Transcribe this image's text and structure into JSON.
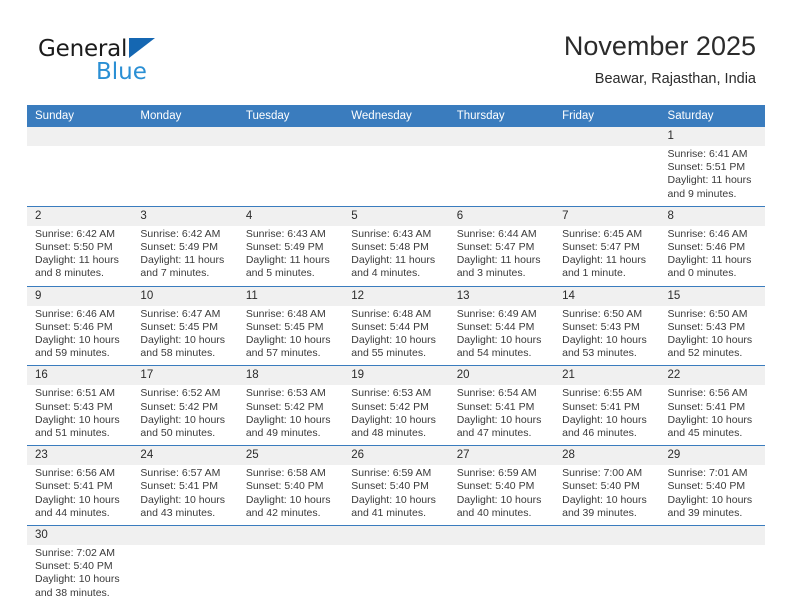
{
  "brand": {
    "name_top": "General",
    "name_bottom": "Blue",
    "accent_color": "#1567b2",
    "accent_light": "#2a8fd4"
  },
  "header": {
    "title": "November 2025",
    "subtitle": "Beawar, Rajasthan, India"
  },
  "theme": {
    "header_blue": "#3a7cbe",
    "date_band": "#f0f0f0",
    "text": "#2b2b2b"
  },
  "calendar": {
    "weekday_headers": [
      "Sunday",
      "Monday",
      "Tuesday",
      "Wednesday",
      "Thursday",
      "Friday",
      "Saturday"
    ],
    "weeks": [
      [
        {
          "day": "",
          "lines": [
            "",
            "",
            "",
            ""
          ]
        },
        {
          "day": "",
          "lines": [
            "",
            "",
            "",
            ""
          ]
        },
        {
          "day": "",
          "lines": [
            "",
            "",
            "",
            ""
          ]
        },
        {
          "day": "",
          "lines": [
            "",
            "",
            "",
            ""
          ]
        },
        {
          "day": "",
          "lines": [
            "",
            "",
            "",
            ""
          ]
        },
        {
          "day": "",
          "lines": [
            "",
            "",
            "",
            ""
          ]
        },
        {
          "day": "1",
          "lines": [
            "Sunrise: 6:41 AM",
            "Sunset: 5:51 PM",
            "Daylight: 11 hours",
            "and 9 minutes."
          ]
        }
      ],
      [
        {
          "day": "2",
          "lines": [
            "Sunrise: 6:42 AM",
            "Sunset: 5:50 PM",
            "Daylight: 11 hours",
            "and 8 minutes."
          ]
        },
        {
          "day": "3",
          "lines": [
            "Sunrise: 6:42 AM",
            "Sunset: 5:49 PM",
            "Daylight: 11 hours",
            "and 7 minutes."
          ]
        },
        {
          "day": "4",
          "lines": [
            "Sunrise: 6:43 AM",
            "Sunset: 5:49 PM",
            "Daylight: 11 hours",
            "and 5 minutes."
          ]
        },
        {
          "day": "5",
          "lines": [
            "Sunrise: 6:43 AM",
            "Sunset: 5:48 PM",
            "Daylight: 11 hours",
            "and 4 minutes."
          ]
        },
        {
          "day": "6",
          "lines": [
            "Sunrise: 6:44 AM",
            "Sunset: 5:47 PM",
            "Daylight: 11 hours",
            "and 3 minutes."
          ]
        },
        {
          "day": "7",
          "lines": [
            "Sunrise: 6:45 AM",
            "Sunset: 5:47 PM",
            "Daylight: 11 hours",
            "and 1 minute."
          ]
        },
        {
          "day": "8",
          "lines": [
            "Sunrise: 6:46 AM",
            "Sunset: 5:46 PM",
            "Daylight: 11 hours",
            "and 0 minutes."
          ]
        }
      ],
      [
        {
          "day": "9",
          "lines": [
            "Sunrise: 6:46 AM",
            "Sunset: 5:46 PM",
            "Daylight: 10 hours",
            "and 59 minutes."
          ]
        },
        {
          "day": "10",
          "lines": [
            "Sunrise: 6:47 AM",
            "Sunset: 5:45 PM",
            "Daylight: 10 hours",
            "and 58 minutes."
          ]
        },
        {
          "day": "11",
          "lines": [
            "Sunrise: 6:48 AM",
            "Sunset: 5:45 PM",
            "Daylight: 10 hours",
            "and 57 minutes."
          ]
        },
        {
          "day": "12",
          "lines": [
            "Sunrise: 6:48 AM",
            "Sunset: 5:44 PM",
            "Daylight: 10 hours",
            "and 55 minutes."
          ]
        },
        {
          "day": "13",
          "lines": [
            "Sunrise: 6:49 AM",
            "Sunset: 5:44 PM",
            "Daylight: 10 hours",
            "and 54 minutes."
          ]
        },
        {
          "day": "14",
          "lines": [
            "Sunrise: 6:50 AM",
            "Sunset: 5:43 PM",
            "Daylight: 10 hours",
            "and 53 minutes."
          ]
        },
        {
          "day": "15",
          "lines": [
            "Sunrise: 6:50 AM",
            "Sunset: 5:43 PM",
            "Daylight: 10 hours",
            "and 52 minutes."
          ]
        }
      ],
      [
        {
          "day": "16",
          "lines": [
            "Sunrise: 6:51 AM",
            "Sunset: 5:43 PM",
            "Daylight: 10 hours",
            "and 51 minutes."
          ]
        },
        {
          "day": "17",
          "lines": [
            "Sunrise: 6:52 AM",
            "Sunset: 5:42 PM",
            "Daylight: 10 hours",
            "and 50 minutes."
          ]
        },
        {
          "day": "18",
          "lines": [
            "Sunrise: 6:53 AM",
            "Sunset: 5:42 PM",
            "Daylight: 10 hours",
            "and 49 minutes."
          ]
        },
        {
          "day": "19",
          "lines": [
            "Sunrise: 6:53 AM",
            "Sunset: 5:42 PM",
            "Daylight: 10 hours",
            "and 48 minutes."
          ]
        },
        {
          "day": "20",
          "lines": [
            "Sunrise: 6:54 AM",
            "Sunset: 5:41 PM",
            "Daylight: 10 hours",
            "and 47 minutes."
          ]
        },
        {
          "day": "21",
          "lines": [
            "Sunrise: 6:55 AM",
            "Sunset: 5:41 PM",
            "Daylight: 10 hours",
            "and 46 minutes."
          ]
        },
        {
          "day": "22",
          "lines": [
            "Sunrise: 6:56 AM",
            "Sunset: 5:41 PM",
            "Daylight: 10 hours",
            "and 45 minutes."
          ]
        }
      ],
      [
        {
          "day": "23",
          "lines": [
            "Sunrise: 6:56 AM",
            "Sunset: 5:41 PM",
            "Daylight: 10 hours",
            "and 44 minutes."
          ]
        },
        {
          "day": "24",
          "lines": [
            "Sunrise: 6:57 AM",
            "Sunset: 5:41 PM",
            "Daylight: 10 hours",
            "and 43 minutes."
          ]
        },
        {
          "day": "25",
          "lines": [
            "Sunrise: 6:58 AM",
            "Sunset: 5:40 PM",
            "Daylight: 10 hours",
            "and 42 minutes."
          ]
        },
        {
          "day": "26",
          "lines": [
            "Sunrise: 6:59 AM",
            "Sunset: 5:40 PM",
            "Daylight: 10 hours",
            "and 41 minutes."
          ]
        },
        {
          "day": "27",
          "lines": [
            "Sunrise: 6:59 AM",
            "Sunset: 5:40 PM",
            "Daylight: 10 hours",
            "and 40 minutes."
          ]
        },
        {
          "day": "28",
          "lines": [
            "Sunrise: 7:00 AM",
            "Sunset: 5:40 PM",
            "Daylight: 10 hours",
            "and 39 minutes."
          ]
        },
        {
          "day": "29",
          "lines": [
            "Sunrise: 7:01 AM",
            "Sunset: 5:40 PM",
            "Daylight: 10 hours",
            "and 39 minutes."
          ]
        }
      ],
      [
        {
          "day": "30",
          "lines": [
            "Sunrise: 7:02 AM",
            "Sunset: 5:40 PM",
            "Daylight: 10 hours",
            "and 38 minutes."
          ]
        },
        {
          "day": "",
          "lines": [
            "",
            "",
            "",
            ""
          ]
        },
        {
          "day": "",
          "lines": [
            "",
            "",
            "",
            ""
          ]
        },
        {
          "day": "",
          "lines": [
            "",
            "",
            "",
            ""
          ]
        },
        {
          "day": "",
          "lines": [
            "",
            "",
            "",
            ""
          ]
        },
        {
          "day": "",
          "lines": [
            "",
            "",
            "",
            ""
          ]
        },
        {
          "day": "",
          "lines": [
            "",
            "",
            "",
            ""
          ]
        }
      ]
    ]
  }
}
